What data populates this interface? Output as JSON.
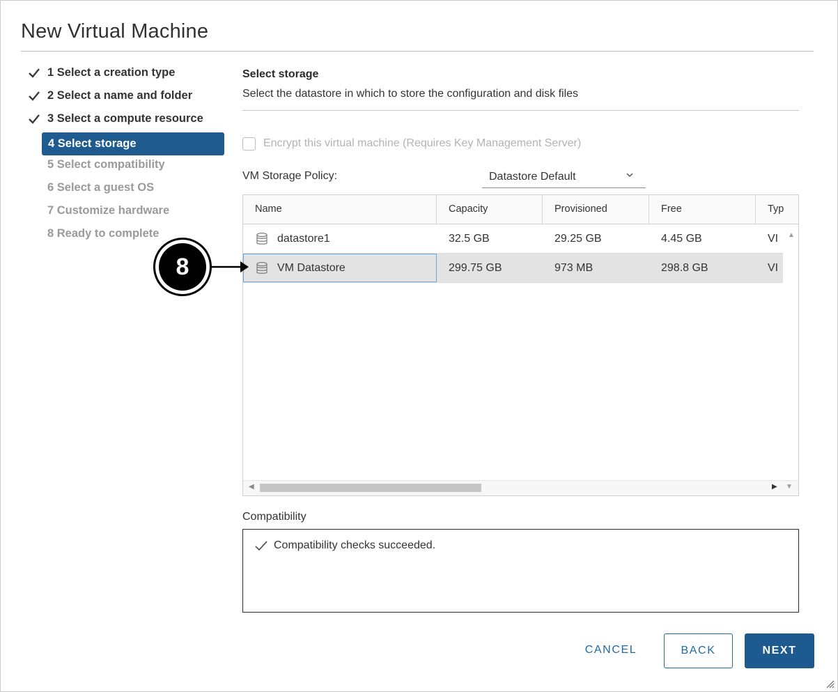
{
  "dialog": {
    "title": "New Virtual Machine"
  },
  "steps": [
    {
      "label": "1 Select a creation type",
      "state": "done"
    },
    {
      "label": "2 Select a name and folder",
      "state": "done"
    },
    {
      "label": "3 Select a compute resource",
      "state": "done"
    },
    {
      "label": "4 Select storage",
      "state": "active"
    },
    {
      "label": "5 Select compatibility",
      "state": "disabled"
    },
    {
      "label": "6 Select a guest OS",
      "state": "disabled"
    },
    {
      "label": "7 Customize hardware",
      "state": "disabled"
    },
    {
      "label": "8 Ready to complete",
      "state": "disabled"
    }
  ],
  "content": {
    "heading": "Select storage",
    "description": "Select the datastore in which to store the configuration and disk files",
    "encrypt_label": "Encrypt this virtual machine (Requires Key Management Server)",
    "policy_label": "VM Storage Policy:",
    "policy_value": "Datastore Default"
  },
  "grid": {
    "columns": [
      "Name",
      "Capacity",
      "Provisioned",
      "Free",
      "Typ"
    ],
    "rows": [
      {
        "name": "datastore1",
        "capacity": "32.5 GB",
        "provisioned": "29.25 GB",
        "free": "4.45 GB",
        "type": "VI"
      },
      {
        "name": "VM Datastore",
        "capacity": "299.75 GB",
        "provisioned": "973 MB",
        "free": "298.8 GB",
        "type": "VI"
      }
    ]
  },
  "compatibility": {
    "label": "Compatibility",
    "message": "Compatibility checks succeeded."
  },
  "buttons": {
    "cancel": "CANCEL",
    "back": "BACK",
    "next": "NEXT"
  },
  "callout": {
    "number": "8"
  },
  "colors": {
    "accent": "#1d5a8f",
    "active_step_bg": "#1f5b8f",
    "selected_row_bg": "#e3e3e3",
    "selection_outline": "#6aa7d8"
  },
  "icons": {
    "step_done": "check-icon",
    "datastore": "database-icon",
    "dropdown": "chevron-down-icon",
    "compat_ok": "check-icon"
  }
}
